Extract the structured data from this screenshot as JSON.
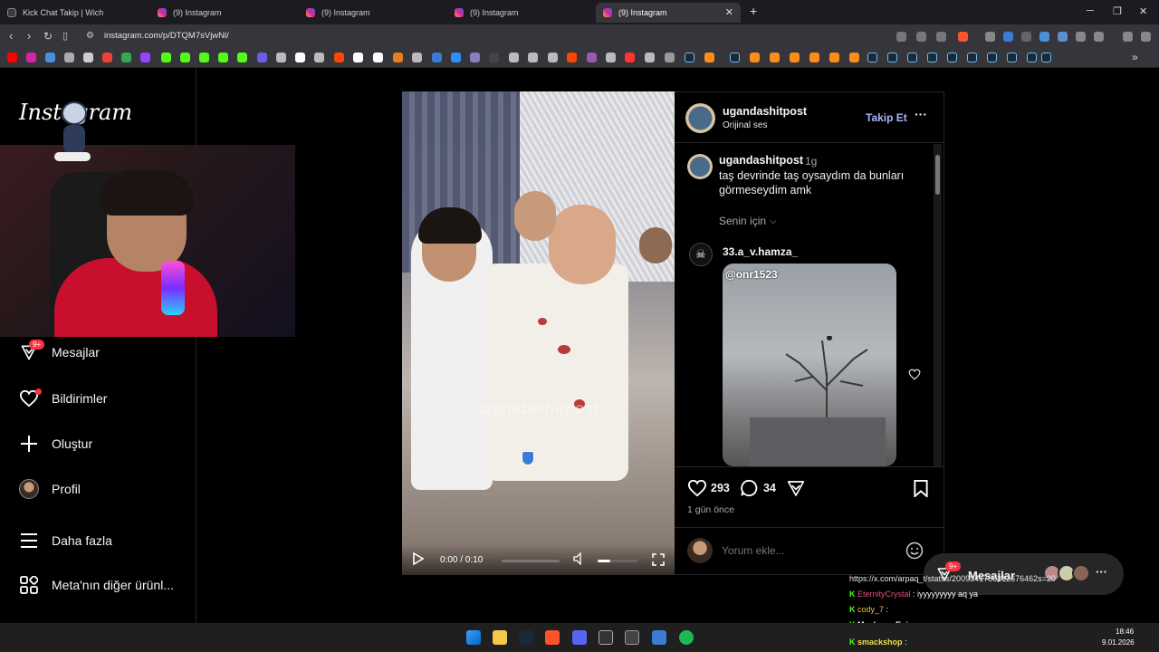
{
  "browser": {
    "tabs": [
      {
        "title": "Kick Chat Takip | Wich",
        "active": false
      },
      {
        "title": "(9) Instagram",
        "active": false
      },
      {
        "title": "(9) Instagram",
        "active": false
      },
      {
        "title": "(9) Instagram",
        "active": false
      },
      {
        "title": "(9) Instagram",
        "active": true
      }
    ],
    "url": "instagram.com/p/DTQM7sVjwNl/",
    "new_tab_glyph": "+"
  },
  "instagram": {
    "logo": "Instagram",
    "sidebar": [
      {
        "label": "Mesajlar",
        "icon": "messenger-icon",
        "badge": "9+"
      },
      {
        "label": "Bildirimler",
        "icon": "heart-icon"
      },
      {
        "label": "Oluştur",
        "icon": "plus-icon"
      },
      {
        "label": "Profil",
        "icon": "avatar"
      },
      {
        "label": "Daha fazla",
        "icon": "menu-icon"
      },
      {
        "label": "Meta'nın diğer ürünl...",
        "icon": "grid-icon"
      }
    ],
    "post": {
      "username": "ugandashitpost",
      "audio": "Orijinal ses",
      "follow": "Takip Et",
      "caption_user": "ugandashitpost",
      "caption_time": "1g",
      "caption_text": "taş devrinde taş oysaydım da bunları görmeseydim amk",
      "for_you": "Senin için",
      "comment_user": "33.a_v.hamza_",
      "comment_image_tag": "@onr1523",
      "watermark": "ugandashitpost",
      "likes": "293",
      "comments": "34",
      "time_ago": "1 gün önce",
      "comment_placeholder": "Yorum ekle...",
      "video_time": "0:00 / 0:10"
    },
    "messages_pill": {
      "label": "Mesajlar",
      "badge": "9+"
    }
  },
  "chat": [
    {
      "user": "",
      "text": "https://x.com/arpaq_t/status/2009341756312676462s=20",
      "color": "#e8e8e8"
    },
    {
      "user": "EternityCrystal",
      "text": ": iyyyyyyyyy aq ya",
      "color": "#e0527c"
    },
    {
      "user": "cody_7",
      "text": ":",
      "color": "#e8c14a"
    },
    {
      "user": "MashrapaEnjoyer",
      "text": ":",
      "color": "#ffffff"
    },
    {
      "user": "smackshop",
      "text": ":",
      "color": "#e8e04a"
    }
  ],
  "taskbar": {
    "time": "18:46",
    "date": "9.01.2026"
  }
}
